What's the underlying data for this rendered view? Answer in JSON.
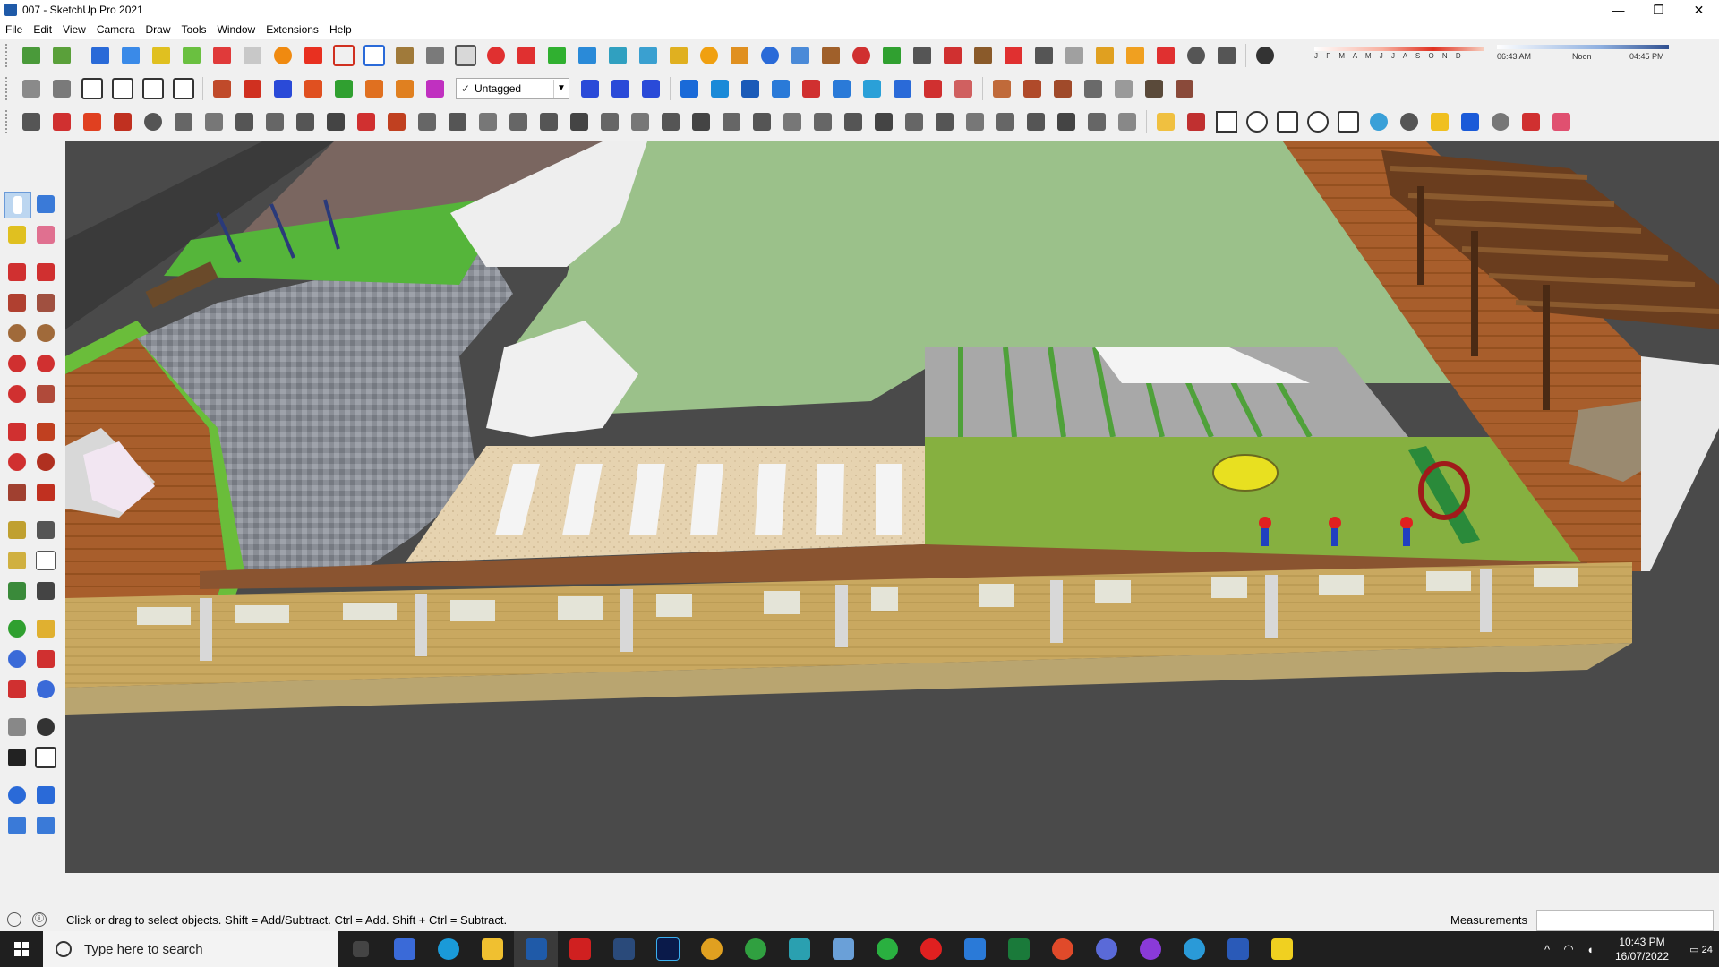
{
  "window": {
    "title": "007 - SketchUp Pro 2021",
    "minimize": "—",
    "maximize": "❐",
    "close": "✕"
  },
  "menu": [
    "File",
    "Edit",
    "View",
    "Camera",
    "Draw",
    "Tools",
    "Window",
    "Extensions",
    "Help"
  ],
  "toolbar": {
    "tag_selector": {
      "check": "✓",
      "value": "Untagged",
      "arrow": "▼"
    },
    "shadow_months": "J F M A M J J A S O N D",
    "shadow_time": {
      "start": "06:43 AM",
      "mid": "Noon",
      "end": "04:45 PM"
    }
  },
  "status": {
    "info": "ⓘ",
    "message": "Click or drag to select objects. Shift = Add/Subtract. Ctrl = Add. Shift + Ctrl = Subtract.",
    "measurements_label": "Measurements",
    "measurements_value": ""
  },
  "taskbar": {
    "search_placeholder": "Type here to search",
    "time": "10:43 PM",
    "date": "16/07/2022",
    "notifications": "24"
  },
  "colors": {
    "accent": "#2b6cb0",
    "lawn": "#9bbf8c",
    "grass": "#7fa83a",
    "wall": "#c8a85a",
    "brick": "#a65d2a",
    "viewport_bg": "#4a4a4a"
  }
}
